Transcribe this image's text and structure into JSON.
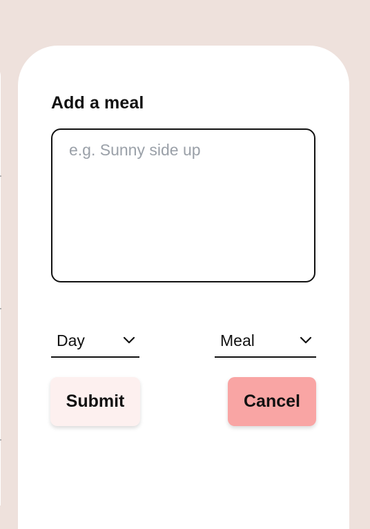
{
  "form": {
    "title": "Add a meal",
    "textarea_placeholder": "e.g. Sunny side up",
    "day_select": {
      "selected": "Day"
    },
    "meal_select": {
      "selected": "Meal"
    },
    "submit_label": "Submit",
    "cancel_label": "Cancel"
  },
  "colors": {
    "page_background": "#eee1dc",
    "modal_background": "#ffffff",
    "submit_background": "#fdf0ef",
    "cancel_background": "#f9a5a4",
    "placeholder_text": "#9aa0a8"
  },
  "icons": {
    "dropdown": "chevron-down-icon"
  }
}
